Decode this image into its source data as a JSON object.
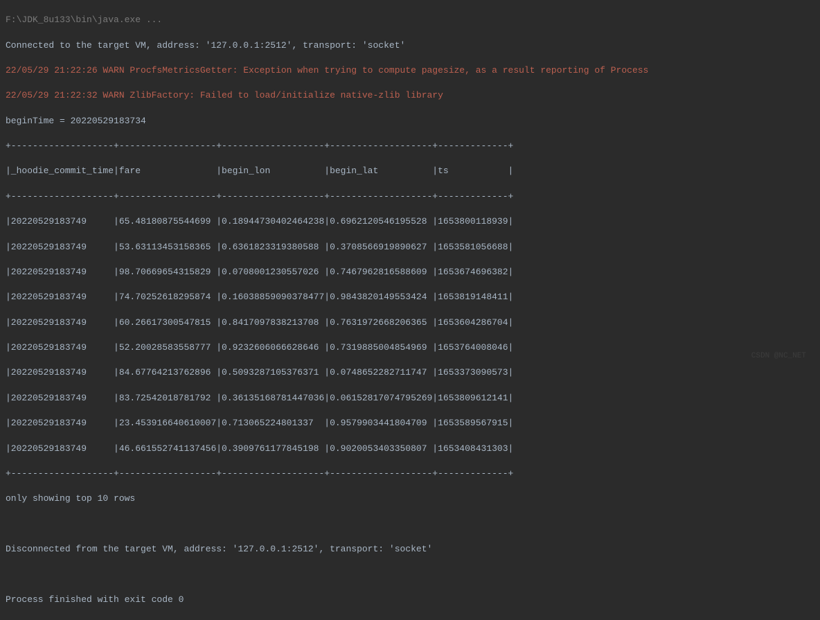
{
  "header": "F:\\JDK_8u133\\bin\\java.exe ...",
  "connected_line": "Connected to the target VM, address: '127.0.0.1:2512', transport: 'socket'",
  "warn1": "22/05/29 21:22:26 WARN ProcfsMetricsGetter: Exception when trying to compute pagesize, as a result reporting of Process",
  "warn2": "22/05/29 21:22:32 WARN ZlibFactory: Failed to load/initialize native-zlib library",
  "begin_time": "beginTime = 20220529183734",
  "separator": "+-------------------+------------------+-------------------+-------------------+-------------+",
  "table_header": "|_hoodie_commit_time|fare              |begin_lon          |begin_lat          |ts           |",
  "table_rows": [
    "|20220529183749     |65.48180875544699 |0.18944730402464238|0.6962120546195528 |1653800118939|",
    "|20220529183749     |53.63113453158365 |0.6361823319380588 |0.3708566919890627 |1653581056688|",
    "|20220529183749     |98.70669654315829 |0.0708001230557026 |0.7467962816588609 |1653674696382|",
    "|20220529183749     |74.70252618295874 |0.16038859090378477|0.9843820149553424 |1653819148411|",
    "|20220529183749     |60.26617300547815 |0.8417097838213708 |0.7631972668206365 |1653604286704|",
    "|20220529183749     |52.20028583558777 |0.9232606066628646 |0.7319885004854969 |1653764008046|",
    "|20220529183749     |84.67764213762896 |0.5093287105376371 |0.0748652282711747 |1653373090573|",
    "|20220529183749     |83.72542018781792 |0.36135168781447036|0.06152817074795269|1653809612141|",
    "|20220529183749     |23.453916640610007|0.713065224801337  |0.9579903441804709 |1653589567915|",
    "|20220529183749     |46.661552741137456|0.3909761177845198 |0.9020053403350807 |1653408431303|"
  ],
  "showing_info": "only showing top 10 rows",
  "disconnected_line": "Disconnected from the target VM, address: '127.0.0.1:2512', transport: 'socket'",
  "exit_line": "Process finished with exit code 0",
  "watermark": "CSDN @NC_NET"
}
